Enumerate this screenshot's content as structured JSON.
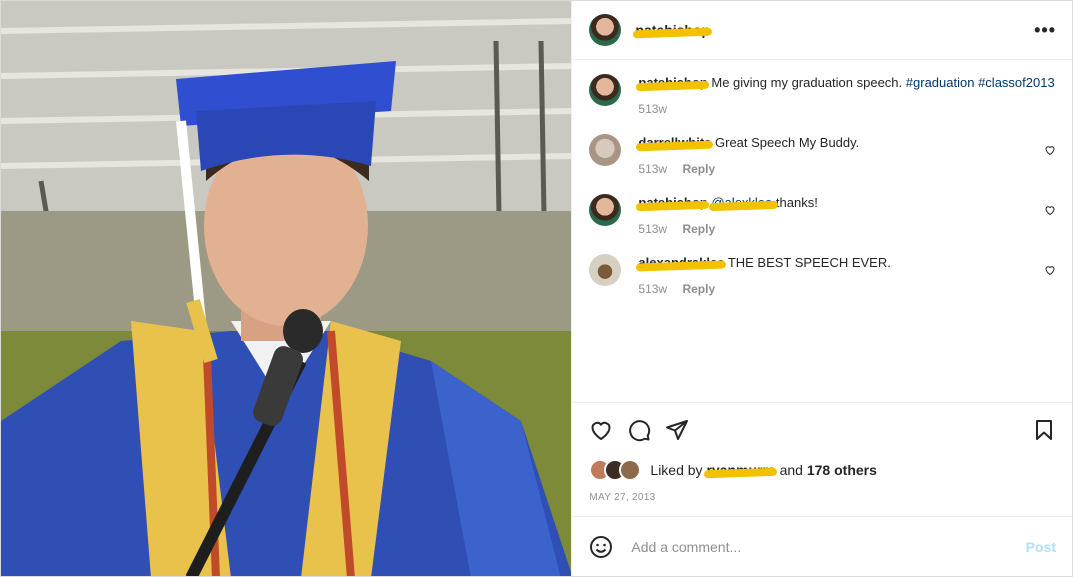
{
  "post": {
    "username": "patebishop",
    "caption": {
      "text": "Me giving my graduation speech.",
      "hashtags": [
        "#graduation",
        "#classof2013"
      ],
      "time": "513w"
    },
    "comments": [
      {
        "username": "darrellwhite",
        "text": "Great Speech My Buddy.",
        "time": "513w",
        "reply": "Reply"
      },
      {
        "username": "patebishop",
        "mention": "@alexklee",
        "text": "thanks!",
        "time": "513w",
        "reply": "Reply"
      },
      {
        "username": "alexandraklee",
        "text": "THE BEST SPEECH EVER.",
        "time": "513w",
        "reply": "Reply"
      }
    ],
    "likes": {
      "prefix": "Liked by",
      "user": "ryanmurra",
      "connector": "and",
      "others": "178 others"
    },
    "date": "MAY 27, 2013",
    "add_comment_placeholder": "Add a comment...",
    "post_button": "Post",
    "more_button": "•••"
  },
  "icons": {
    "like": "heart-icon",
    "comment": "comment-icon",
    "share": "share-icon",
    "save": "bookmark-icon",
    "emoji": "emoji-icon"
  },
  "colors": {
    "link": "#00376b",
    "redaction": "#f2c200",
    "post_disabled": "#b2dffc",
    "gown": "#2f4fb5",
    "stole": "#e8c24a"
  }
}
